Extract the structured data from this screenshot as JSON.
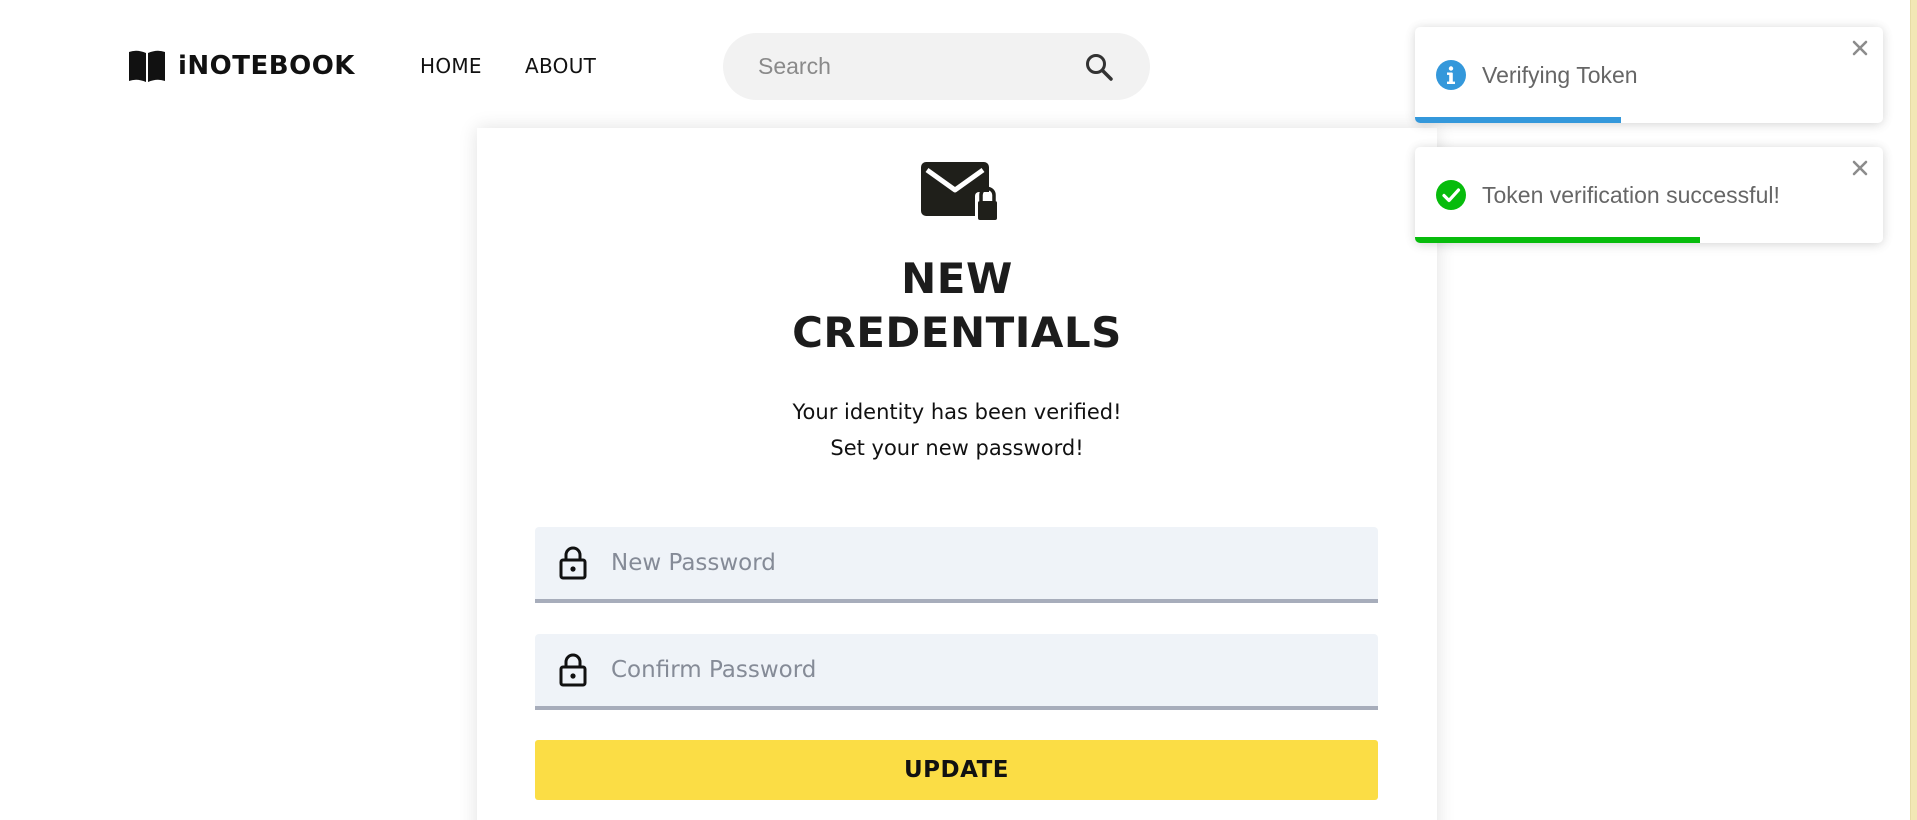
{
  "navbar": {
    "brand": "iNOTEBOOK",
    "brand_icon": "open-book-icon",
    "links": [
      "HOME",
      "ABOUT"
    ],
    "search": {
      "placeholder": "Search",
      "icon": "search-icon"
    }
  },
  "card": {
    "icon": "mail-lock-icon",
    "title_line1": "NEW",
    "title_line2": "CREDENTIALS",
    "subtitle_line1": "Your identity has been verified!",
    "subtitle_line2": "Set your new password!",
    "fields": [
      {
        "placeholder": "New Password",
        "icon": "lock-icon"
      },
      {
        "placeholder": "Confirm Password",
        "icon": "lock-icon"
      }
    ],
    "button": "UPDATE",
    "button_color": "#fbdd45"
  },
  "toasts": [
    {
      "message": "Verifying Token",
      "type": "info",
      "icon": "info-icon",
      "color": "#3498db",
      "progress": 0.44
    },
    {
      "message": "Token verification successful!",
      "type": "success",
      "icon": "check-circle-icon",
      "color": "#07bc0c",
      "progress": 0.61
    }
  ]
}
